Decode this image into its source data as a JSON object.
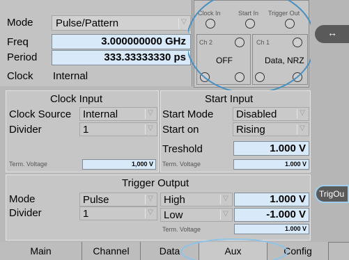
{
  "header": {
    "mode_label": "Mode",
    "mode_value": "Pulse/Pattern",
    "freq_label": "Freq",
    "freq_value": "3.000000000 GHz",
    "period_label": "Period",
    "period_value": "333.33333330 ps",
    "clock_label": "Clock",
    "clock_value": "Internal"
  },
  "connectors": {
    "clock_in": "Clock In",
    "start_in": "Start In",
    "trigger_out": "Trigger Out",
    "ch2": "Ch 2",
    "ch2_status": "OFF",
    "ch1": "Ch 1",
    "ch1_status": "Data, NRZ"
  },
  "clock_input": {
    "title": "Clock Input",
    "source_label": "Clock Source",
    "source_value": "Internal",
    "divider_label": "Divider",
    "divider_value": "1",
    "term_label": "Term. Voltage",
    "term_value": "1,000 V"
  },
  "start_input": {
    "title": "Start Input",
    "mode_label": "Start Mode",
    "mode_value": "Disabled",
    "on_label": "Start on",
    "on_value": "Rising",
    "threshold_label": "Treshold",
    "threshold_value": "1.000 V",
    "term_label": "Term. Voltage",
    "term_value": "1.000 V"
  },
  "trigger_output": {
    "title": "Trigger Output",
    "mode_label": "Mode",
    "mode_value": "Pulse",
    "divider_label": "Divider",
    "divider_value": "1",
    "high_label": "High",
    "high_value": "1.000 V",
    "low_label": "Low",
    "low_value": "-1.000 V",
    "term_label": "Term. Voltage",
    "term_value": "1.000 V"
  },
  "side": {
    "trigout_label": "TrigOu",
    "arrows_icon": "move-arrows-icon"
  },
  "tabs": [
    {
      "label": "Main"
    },
    {
      "label": "Channel"
    },
    {
      "label": "Data"
    },
    {
      "label": "Aux"
    },
    {
      "label": "Config"
    }
  ],
  "colors": {
    "field_bg": "#d8eaf9",
    "panel_bg": "#c6c6c6",
    "highlight": "#9fd0f0"
  }
}
